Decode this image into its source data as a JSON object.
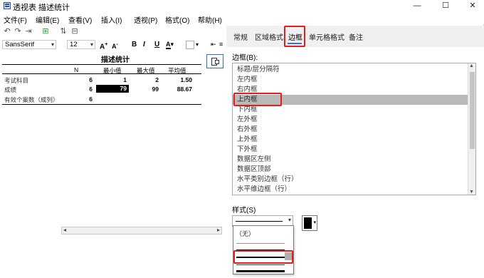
{
  "window": {
    "title": "透视表 描述统计",
    "controls": [
      "—",
      "☐",
      "✕"
    ]
  },
  "menu": [
    {
      "label": "文件(F)"
    },
    {
      "label": "编辑(E)"
    },
    {
      "label": "查看(V)"
    },
    {
      "label": "插入(I)"
    },
    {
      "label": "透视(P)"
    },
    {
      "label": "格式(O)"
    },
    {
      "label": "帮助(H)"
    }
  ],
  "format_toolbar": {
    "font": "SansSerif",
    "size": "12",
    "bold": "B",
    "italic": "I",
    "underline": "U",
    "grow": "A",
    "shrink": "A"
  },
  "table": {
    "title": "描述统计",
    "headers": [
      "N",
      "最小值",
      "最大值",
      "平均值"
    ],
    "rows": [
      {
        "label": "考试科目",
        "n": "6",
        "min": "1",
        "max": "2",
        "mean": "1.50"
      },
      {
        "label": "成绩",
        "n": "6",
        "min": "79",
        "max": "99",
        "mean": "88.67"
      },
      {
        "label": "有效个案数（成列）",
        "n": "6",
        "min": "",
        "max": "",
        "mean": ""
      }
    ]
  },
  "tabs": [
    {
      "label": "常规"
    },
    {
      "label": "区域格式"
    },
    {
      "label": "边框"
    },
    {
      "label": "单元格格式"
    },
    {
      "label": "备注"
    }
  ],
  "border_panel": {
    "list_label": "边框(B):",
    "items": [
      "标题/层分隔符",
      "左内框",
      "右内框",
      "上内框",
      "下内框",
      "左外框",
      "右外框",
      "上外框",
      "下外框",
      "数据区左侧",
      "数据区顶部",
      "水平类别边框（行）",
      "水平维边框（行）"
    ],
    "selected_index": 3,
    "style_label": "样式(S)",
    "color": "#000000"
  },
  "style_dropdown": {
    "none_label": "（无）"
  },
  "colors": {
    "highlight": "#e0201e",
    "accent": "#3c73c8",
    "selected_row": "#b9b9b9"
  }
}
